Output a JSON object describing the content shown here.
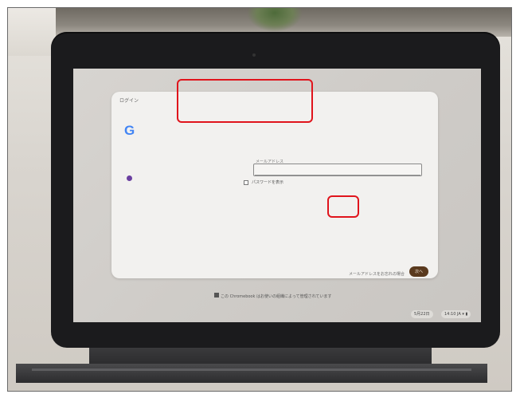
{
  "card": {
    "title": "ログイン",
    "account_label": "",
    "input_label": "メールアドレス",
    "email_value": "",
    "show_password_label": "パスワードを表示",
    "forgot_link": "メールアドレスをお忘れの場合",
    "next_button": "次へ"
  },
  "footer": {
    "note": "この Chromebook はお使いの組織によって管理されています"
  },
  "status_bar": {
    "date": "5月22日",
    "time": "14:10",
    "indicators": "JA"
  },
  "colors": {
    "annotation": "#e0141c",
    "next_button": "#5a3a1e",
    "google_blue": "#4285f4"
  },
  "icons": [
    "google-logo-icon",
    "account-icon",
    "wifi-icon",
    "battery-icon",
    "enterprise-icon"
  ]
}
